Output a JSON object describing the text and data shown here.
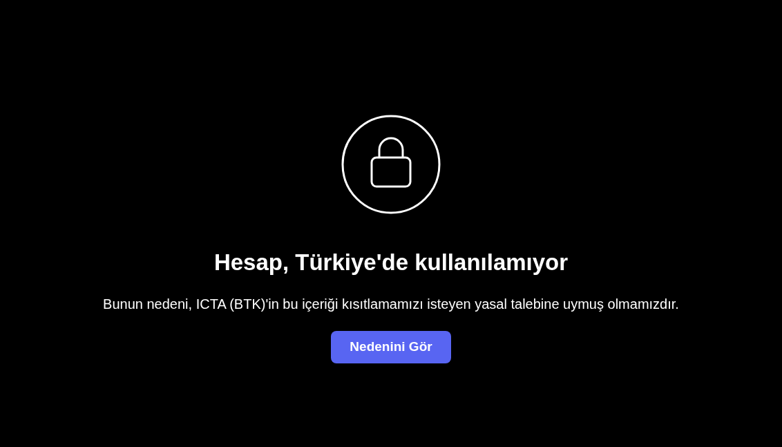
{
  "title": "Hesap, Türkiye'de kullanılamıyor",
  "message": "Bunun nedeni, ICTA (BTK)'in bu içeriği kısıtlamamızı isteyen yasal talebine uymuş olmamızdır.",
  "button": {
    "label": "Nedenini Gör"
  }
}
